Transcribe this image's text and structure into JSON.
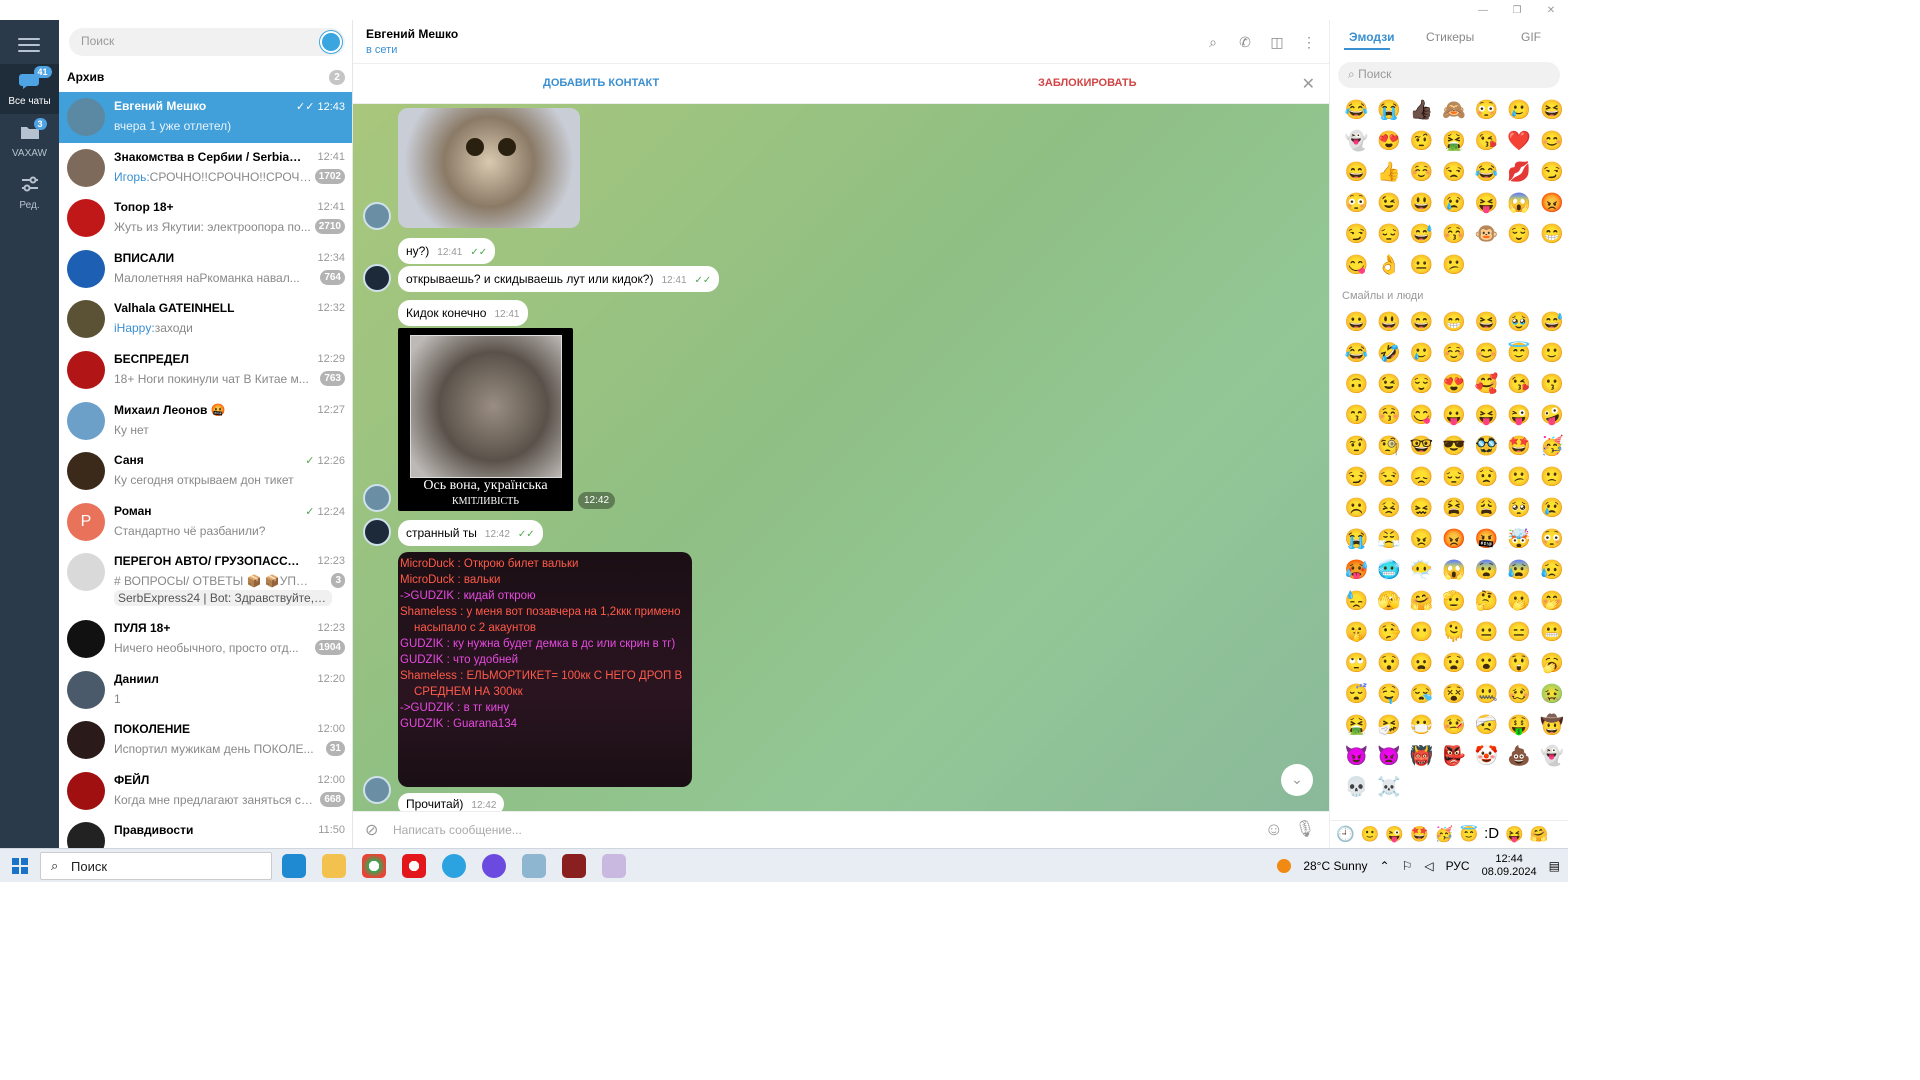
{
  "window": {
    "title_buttons": [
      "—",
      "❐",
      "✕"
    ]
  },
  "rail": {
    "items": [
      {
        "label": "Все чаты",
        "badge": "41"
      },
      {
        "label": "VAXAW",
        "badge": "3"
      },
      {
        "label": "Ред."
      }
    ]
  },
  "search": {
    "placeholder": "Поиск"
  },
  "archive": {
    "label": "Архив",
    "count": "2"
  },
  "chats": [
    {
      "name": "Евгений Мешко",
      "time": "12:43",
      "message": "вчера 1 уже отлетел)",
      "read": true,
      "color": "#5b88a3"
    },
    {
      "name": "Знакомства в Сербии / Serbia Da...",
      "time": "12:41",
      "sender": "Игорь:",
      "message": "СРОЧНО!!СРОЧНО!!СРОЧНО!!...",
      "unread": "1702",
      "color": "#7d6a5a"
    },
    {
      "name": "Топор 18+",
      "time": "12:41",
      "message": "Жуть из Якутии: электроопора по...",
      "unread": "2710",
      "color": "#c01818"
    },
    {
      "name": "ВПИСАЛИ",
      "time": "12:34",
      "message": "Малолетняя наРкоманка навал...",
      "unread": "764",
      "color": "#1c5fb3"
    },
    {
      "name": "Valhala GATEINHELL",
      "time": "12:32",
      "sender": "iHappy:",
      "message": "заходи",
      "color": "#5b5135"
    },
    {
      "name": "БЕСПРЕДЕЛ",
      "time": "12:29",
      "message": "18+ Ноги покинули чат  В Китае м...",
      "unread": "763",
      "color": "#b11515"
    },
    {
      "name": "Михаил Леонов 🤬",
      "time": "12:27",
      "message": "Ку нет",
      "color": "#6ca0c9"
    },
    {
      "name": "Саня",
      "time": "12:26",
      "message": "Ку сегодня открываем дон тикет",
      "read": true,
      "color": "#3b2a1a"
    },
    {
      "name": "Роман",
      "time": "12:24",
      "message": "Стандартно чё разбанили?",
      "read": true,
      "color": "#e8735a",
      "letter": "Р"
    },
    {
      "name": "ПЕРЕГОН АВТО/ ГРУЗОПАССАЖ...",
      "time": "12:23",
      "message": "# ВОПРОСЫ/ ОТВЕТЫ  📦 📦УПАКО...",
      "sub": "SerbExpress24 | Bot: Здравствуйте, Еле...",
      "unread": "3",
      "color": "#d9d9d9"
    },
    {
      "name": "ПУЛЯ 18+",
      "time": "12:23",
      "message": "Ничего необычного, просто отд...",
      "unread": "1904",
      "color": "#111"
    },
    {
      "name": "Даниил",
      "time": "12:20",
      "message": "1",
      "color": "#4a5a6a"
    },
    {
      "name": "ПОКОЛЕНИЕ",
      "time": "12:00",
      "message": "Испортил мужикам день  ПОКОЛЕ...",
      "unread": "31",
      "color": "#2a1a1a"
    },
    {
      "name": "ФЕЙЛ",
      "time": "12:00",
      "message": "Когда мне предлагают заняться сп...",
      "unread": "668",
      "color": "#a01010"
    },
    {
      "name": "Правдивости",
      "time": "11:50",
      "message": "",
      "color": "#222"
    }
  ],
  "header": {
    "name": "Евгений Мешко",
    "status": "в сети"
  },
  "bar": {
    "add": "ДОБАВИТЬ КОНТАКТ",
    "block": "ЗАБЛОКИРОВАТЬ"
  },
  "messages": [
    {
      "text": "ну?)",
      "time": "12:41"
    },
    {
      "text": "открываешь? и скидываешь лут или кидок?)",
      "time": "12:41"
    },
    {
      "text": "Кидок конечно",
      "time": "12:41"
    },
    {
      "caption": "Ось вона, українська",
      "subcaption": "КМІТЛИВІСТЬ",
      "time": "12:42"
    },
    {
      "text": "странный ты",
      "time": "12:42"
    },
    {
      "text": "Прочитай)",
      "time": "12:42"
    }
  ],
  "chatlog": [
    {
      "name": "MicroDuck :",
      "text": " Открою билет вальки"
    },
    {
      "name": "MicroDuck :",
      "text": " вальки"
    },
    {
      "name": "->GUDZIK :",
      "text": "  кидай открою"
    },
    {
      "name": "Shameless :",
      "text": " у меня вот позавчера на 1,2ккк примено насыпало с 2 акаунтов"
    },
    {
      "name": "GUDZIK :",
      "text": " ку нужна будет демка в дс или скрин в тг)"
    },
    {
      "name": "GUDZIK :",
      "text": " что удобней"
    },
    {
      "name": "Shameless :",
      "text": " ЕЛЬМОРТИКЕТ= 100кк С НЕГО ДРОП В СРЕДНЕМ НА 300кк"
    },
    {
      "name": "->GUDZIK :",
      "text": "  в тг кину"
    },
    {
      "name": "GUDZIK :",
      "text": " Guarana134"
    }
  ],
  "compose": {
    "placeholder": "Написать сообщение..."
  },
  "emoji": {
    "tabs": [
      "Эмодзи",
      "Стикеры",
      "GIF"
    ],
    "search": "Поиск",
    "category": "Смайлы и люди",
    "recent": [
      "😂",
      "😭",
      "👍🏿",
      "🙈",
      "😳",
      "🥲",
      "😆",
      "👻",
      "😍",
      "🤨",
      "🤮",
      "😘",
      "❤️",
      "😊",
      "😄",
      "👍",
      "☺️",
      "😒",
      "😂",
      "💋",
      "😏",
      "😳",
      "😉",
      "😃",
      "😢",
      "😝",
      "😱",
      "😡",
      "😏",
      "😔",
      "😅",
      "😚",
      "🐵",
      "😌",
      "😁",
      "😋",
      "👌",
      "😐",
      "😕"
    ],
    "people": [
      "😀",
      "😃",
      "😄",
      "😁",
      "😆",
      "🥹",
      "😅",
      "😂",
      "🤣",
      "🥲",
      "☺️",
      "😊",
      "😇",
      "🙂",
      "🙃",
      "😉",
      "😌",
      "😍",
      "🥰",
      "😘",
      "😗",
      "😙",
      "😚",
      "😋",
      "😛",
      "😝",
      "😜",
      "🤪",
      "🤨",
      "🧐",
      "🤓",
      "😎",
      "🥸",
      "🤩",
      "🥳",
      "😏",
      "😒",
      "😞",
      "😔",
      "😟",
      "😕",
      "🙁",
      "☹️",
      "😣",
      "😖",
      "😫",
      "😩",
      "🥺",
      "😢",
      "😭",
      "😤",
      "😠",
      "😡",
      "🤬",
      "🤯",
      "😳",
      "🥵",
      "🥶",
      "😶‍🌫️",
      "😱",
      "😨",
      "😰",
      "😥",
      "😓",
      "🫣",
      "🤗",
      "🫡",
      "🤔",
      "🫢",
      "🤭",
      "🤫",
      "🤥",
      "😶",
      "🫠",
      "😐",
      "😑",
      "😬",
      "🙄",
      "😯",
      "😦",
      "😧",
      "😮",
      "😲",
      "🥱",
      "😴",
      "🤤",
      "😪",
      "😵",
      "🤐",
      "🥴",
      "🤢",
      "🤮",
      "🤧",
      "😷",
      "🤒",
      "🤕",
      "🤑",
      "🤠",
      "😈",
      "👿",
      "👹",
      "👺",
      "🤡",
      "💩",
      "👻",
      "💀",
      "☠️"
    ],
    "footer": [
      "🕘",
      "🙂",
      "😜",
      "🤩",
      "🥳",
      "😇",
      ":D",
      "😝",
      "🤗"
    ]
  },
  "taskbar": {
    "search": "Поиск",
    "weather": "28°C  Sunny",
    "lang": "РУС",
    "time": "12:44",
    "date": "08.09.2024"
  }
}
